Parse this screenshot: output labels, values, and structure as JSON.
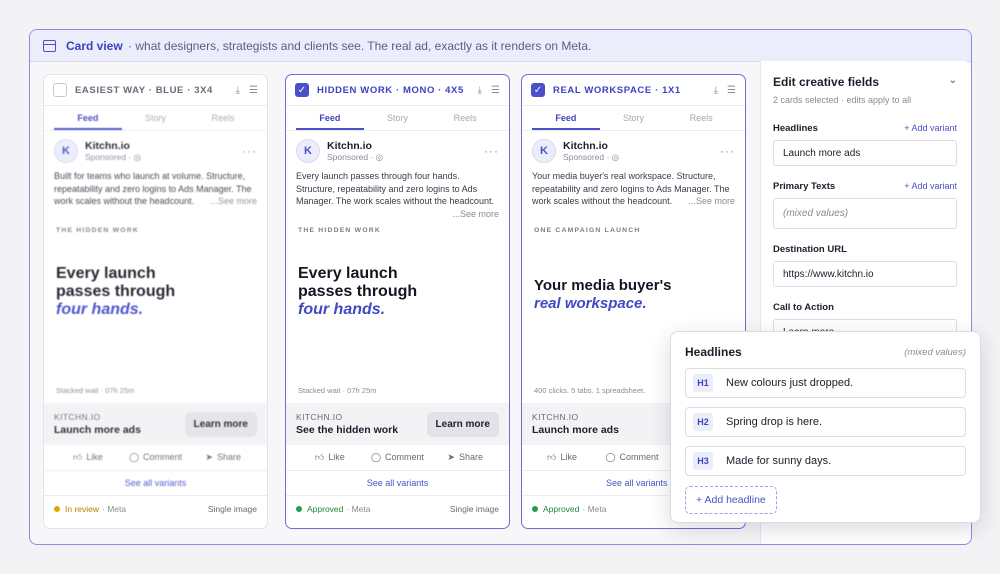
{
  "header": {
    "title": "Card view",
    "description": "· what designers, strategists and clients see. The real ad, exactly as it renders on Meta."
  },
  "cards": [
    {
      "checked": false,
      "title": "EASIEST WAY · BLUE · 3X4",
      "tabs": [
        "Feed",
        "Story",
        "Reels"
      ],
      "brand": "Kitchn.io",
      "sponsored": "Sponsored · ◎",
      "primary_text": "Built for teams who launch at volume. Structure, repeatability and zero logins to Ads Manager. The work scales without the headcount.",
      "see_more": "...See more",
      "kicker": "THE HIDDEN WORK",
      "headline_1": "Every launch",
      "headline_2": "passes through",
      "headline_accent": "four hands.",
      "footnote": "Stacked wait · 07h 25m",
      "domain": "KITCHN.IO",
      "cta_headline": "Launch more ads",
      "cta_button": "Learn more",
      "actions": [
        "Like",
        "Comment",
        "Share"
      ],
      "variants_link": "See all variants",
      "status": "In review",
      "status_meta": "· Meta",
      "format": "Single image"
    },
    {
      "checked": true,
      "title": "HIDDEN WORK · MONO · 4X5",
      "tabs": [
        "Feed",
        "Story",
        "Reels"
      ],
      "brand": "Kitchn.io",
      "sponsored": "Sponsored · ◎",
      "primary_text": "Every launch passes through four hands. Structure, repeatability and zero logins to Ads Manager. The work scales without the headcount.",
      "see_more": "...See more",
      "kicker": "THE HIDDEN WORK",
      "headline_1": "Every launch",
      "headline_2": "passes through",
      "headline_accent": "four hands.",
      "footnote": "Stacked wait · 07h 25m",
      "domain": "KITCHN.IO",
      "cta_headline": "See the hidden work",
      "cta_button": "Learn more",
      "actions": [
        "Like",
        "Comment",
        "Share"
      ],
      "variants_link": "See all variants",
      "status": "Approved",
      "status_meta": "· Meta",
      "format": "Single image"
    },
    {
      "checked": true,
      "title": "REAL WORKSPACE · 1X1",
      "tabs": [
        "Feed",
        "Story",
        "Reels"
      ],
      "brand": "Kitchn.io",
      "sponsored": "Sponsored · ◎",
      "primary_text": "Your media buyer's real workspace. Structure, repeatability and zero logins to Ads Manager. The work scales without the headcount.",
      "see_more": "...See more",
      "kicker": "ONE CAMPAIGN LAUNCH",
      "headline_1": "Your media buyer's",
      "headline_2": "",
      "headline_accent": "real workspace.",
      "footnote": "400 clicks. 5 tabs. 1 spreadsheet.",
      "domain": "KITCHN.IO",
      "cta_headline": "Launch more ads",
      "cta_button": "",
      "actions": [
        "Like",
        "Comment"
      ],
      "variants_link": "See all variants",
      "status": "Approved",
      "status_meta": "· Meta",
      "format": ""
    }
  ],
  "panel": {
    "title": "Edit creative fields",
    "subtitle": "2 cards selected · edits apply to all",
    "headlines_label": "Headlines",
    "add_variant": "+ Add variant",
    "headline_value": "Launch more ads",
    "primary_label": "Primary Texts",
    "primary_value": "(mixed values)",
    "url_label": "Destination URL",
    "url_value": "https://www.kitchn.io",
    "cta_label": "Call to Action",
    "cta_value": "Learn more"
  },
  "popup": {
    "title": "Headlines",
    "mixed": "(mixed values)",
    "rows": [
      {
        "badge": "H1",
        "text": "New colours just dropped."
      },
      {
        "badge": "H2",
        "text": "Spring drop is here."
      },
      {
        "badge": "H3",
        "text": "Made for sunny days."
      }
    ],
    "add_label": "+ Add headline"
  },
  "colors": {
    "accent": "#4b50c8",
    "review": "#e3a800",
    "approved": "#22a145"
  }
}
